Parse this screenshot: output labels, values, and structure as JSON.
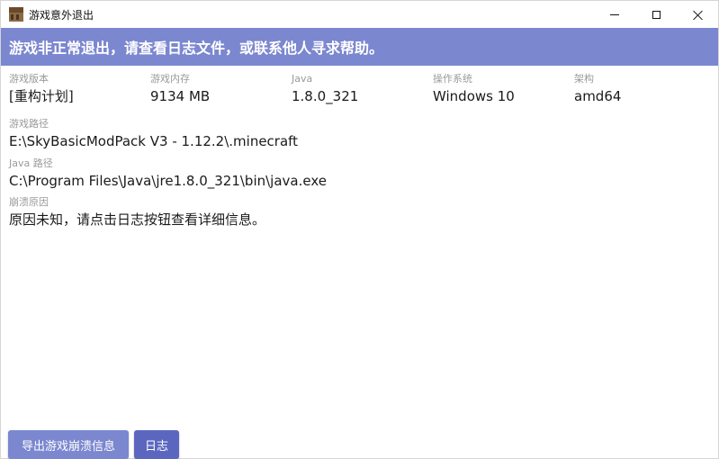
{
  "window": {
    "title": "游戏意外退出",
    "icon": "crafting-table-icon",
    "controls": {
      "minimize": "minimize-icon",
      "maximize": "maximize-icon",
      "close": "close-icon"
    }
  },
  "banner": {
    "text": "游戏非正常退出，请查看日志文件，或联系他人寻求帮助。",
    "color": "#7b87cf"
  },
  "info": [
    {
      "label": "游戏版本",
      "value": "[重构计划]"
    },
    {
      "label": "游戏内存",
      "value": "9134 MB"
    },
    {
      "label": "Java",
      "value": "1.8.0_321"
    },
    {
      "label": "操作系统",
      "value": "Windows 10"
    },
    {
      "label": "架构",
      "value": "amd64"
    }
  ],
  "game_path": {
    "label": "游戏路径",
    "value": "E:\\SkyBasicModPack V3 - 1.12.2\\.minecraft"
  },
  "java_path": {
    "label": "Java 路径",
    "value": "C:\\Program Files\\Java\\jre1.8.0_321\\bin\\java.exe"
  },
  "crash_reason": {
    "label": "崩溃原因",
    "value": "原因未知，请点击日志按钮查看详细信息。"
  },
  "buttons": {
    "export": "导出游戏崩溃信息",
    "log": "日志"
  }
}
